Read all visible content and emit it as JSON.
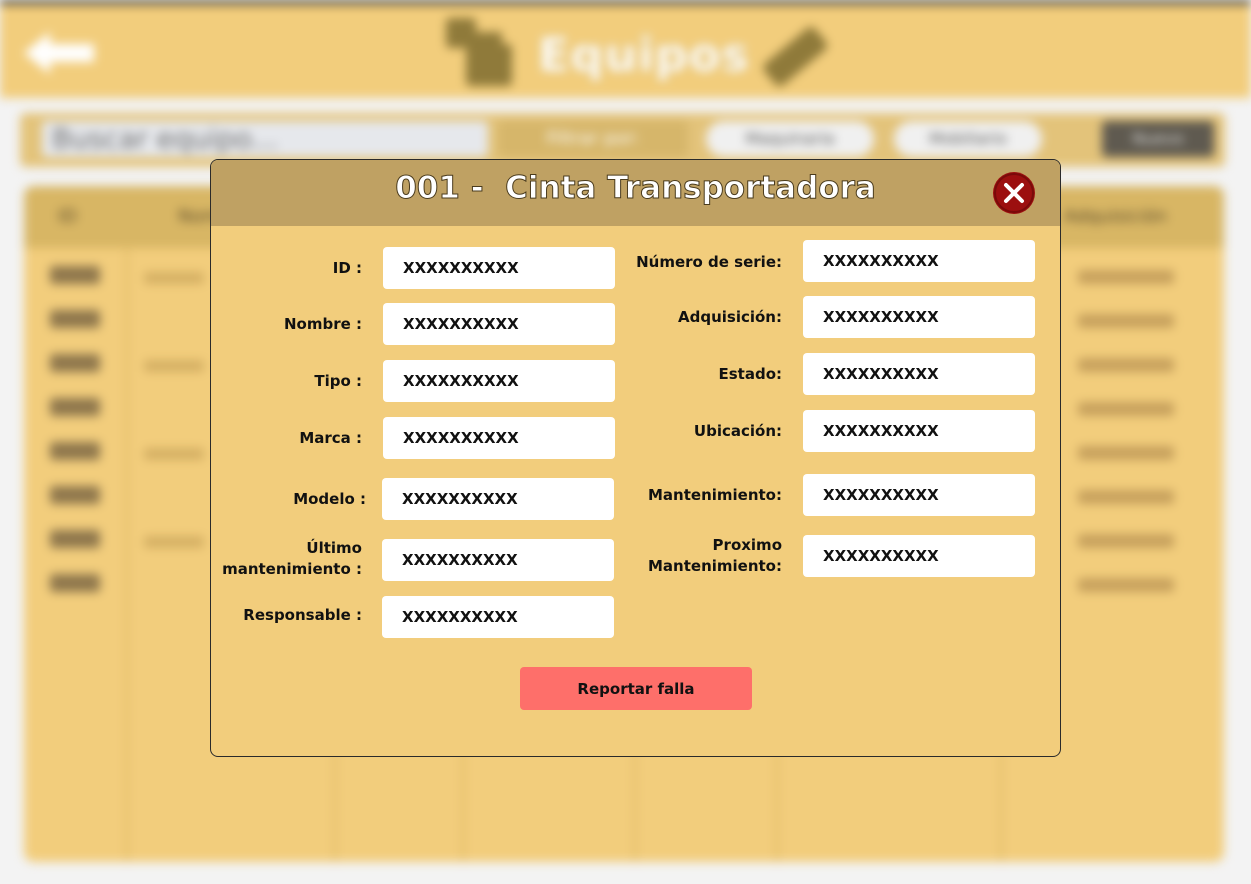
{
  "app": {
    "title": "Equipos",
    "search_placeholder": "Buscar equipo...",
    "filter_label": "Filtrar por:",
    "chip_1": "Maquinaria",
    "chip_2": "Mobiliario",
    "action_label": "Nuevo",
    "table": {
      "col_id": "ID",
      "col_nombre": "Nombre",
      "col_last": "Adquisición"
    }
  },
  "modal": {
    "title": "001 -  Cinta Transportadora",
    "left_fields": [
      {
        "label": "ID :",
        "value": "XXXXXXXXXX"
      },
      {
        "label": "Nombre :",
        "value": "XXXXXXXXXX"
      },
      {
        "label": "Tipo :",
        "value": "XXXXXXXXXX"
      },
      {
        "label": "Marca :",
        "value": "XXXXXXXXXX"
      },
      {
        "label": "Modelo :",
        "value": "XXXXXXXXXX"
      },
      {
        "label": "Último\nmantenimiento :",
        "value": "XXXXXXXXXX"
      },
      {
        "label": "Responsable :",
        "value": "XXXXXXXXXX"
      }
    ],
    "right_fields": [
      {
        "label": "Número de serie:",
        "value": "XXXXXXXXXX"
      },
      {
        "label": "Adquisición:",
        "value": "XXXXXXXXXX"
      },
      {
        "label": "Estado:",
        "value": "XXXXXXXXXX"
      },
      {
        "label": "Ubicación:",
        "value": "XXXXXXXXXX"
      },
      {
        "label": "Mantenimiento:",
        "value": "XXXXXXXXXX"
      },
      {
        "label": "Proximo\nMantenimiento:",
        "value": "XXXXXXXXXX"
      }
    ],
    "report_button": "Reportar falla"
  },
  "colors": {
    "background_panel": "#f2cd7c",
    "modal_header": "#bfa163",
    "close_button": "#9c0f0f",
    "report_button": "#fe6f6a"
  },
  "icons": [
    "back-arrow-icon",
    "equipment-icon",
    "tag-icon",
    "close-icon"
  ]
}
